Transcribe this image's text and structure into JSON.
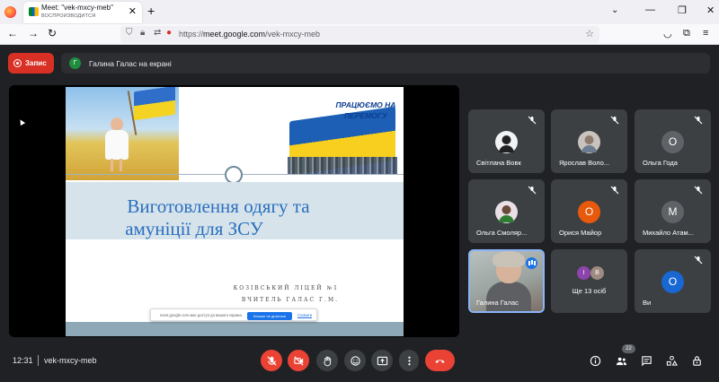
{
  "browser": {
    "tab_title": "Meet: \"vek-mxcy-meb\"",
    "tab_subtitle": "ВОСПРОИЗВОДИТСЯ",
    "url_prefix": "https://",
    "url_domain": "meet.google.com",
    "url_path": "/vek-mxcy-meb"
  },
  "meet": {
    "record_label": "Запис",
    "presenter_initial": "Г",
    "presenter_text": "Галина Галас на екрані"
  },
  "slide": {
    "banner_text": "ПРАЦЮЄМО НА ПЕРЕМОГУ",
    "title_line1": "Виготовлення одягу та",
    "title_line2": "амуніції для ЗСУ",
    "school_line1": "КОЗІВСЬКИЙ ЛІЦЕЙ №1",
    "school_line2": "ВЧИТЕЛЬ ГАЛАС Г.М.",
    "share_notice": "meet.google.com має доступ до вашого екрана.",
    "share_stop": "Більше не ділитися",
    "share_hide": "Сховати"
  },
  "participants": [
    {
      "name": "Світлана Вовк",
      "initial": "",
      "color": "#f1f3f4"
    },
    {
      "name": "Ярослав Воло...",
      "initial": "",
      "color": "#c9c3bd"
    },
    {
      "name": "Ольга Года",
      "initial": "О",
      "color": "#5f6368"
    },
    {
      "name": "Ольга Смоляр...",
      "initial": "",
      "color": "#e8e0e4"
    },
    {
      "name": "Орися Майор",
      "initial": "О",
      "color": "#e8590c"
    },
    {
      "name": "Михайло Атам...",
      "initial": "М",
      "color": "#5f6368"
    },
    {
      "name": "Галина Галас",
      "initial": "",
      "color": ""
    },
    {
      "name": "Ще 13 осіб",
      "initial": "",
      "color": ""
    },
    {
      "name": "Ви",
      "initial": "О",
      "color": "#1967d2"
    }
  ],
  "more_avatars": [
    {
      "initial": "І",
      "color": "#8e44ad"
    },
    {
      "initial": "В",
      "color": "#9e8b80"
    }
  ],
  "bottom": {
    "time": "12:31",
    "meeting_code": "vek-mxcy-meb",
    "people_count": "22"
  }
}
